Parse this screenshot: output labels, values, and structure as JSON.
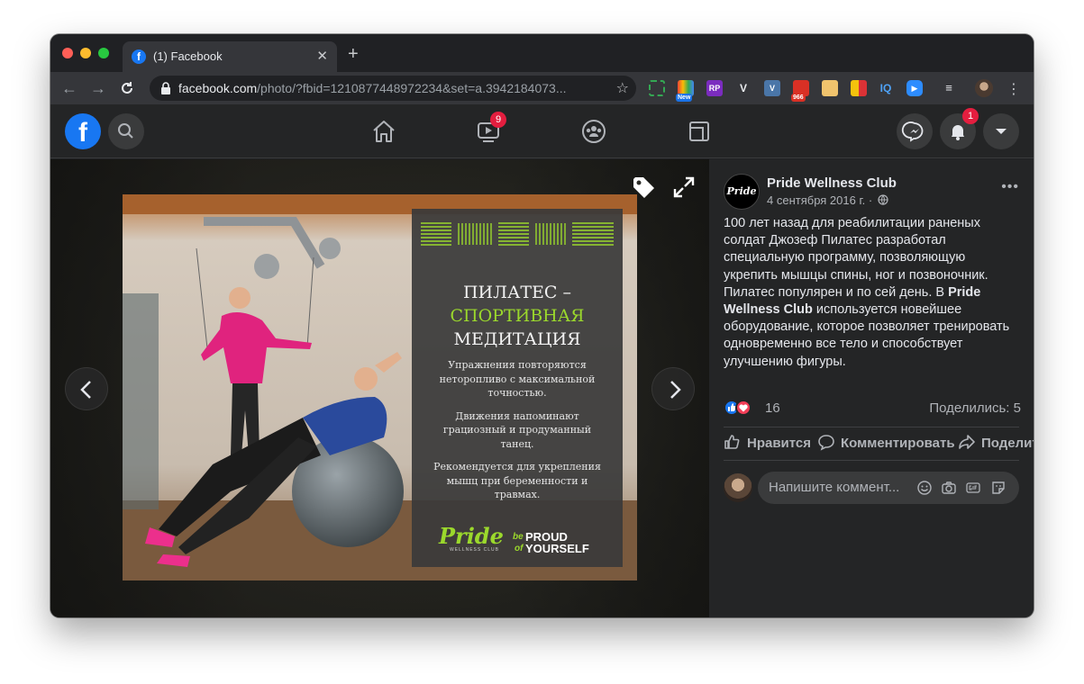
{
  "browser": {
    "tab_title": "(1) Facebook",
    "url_host": "facebook.com",
    "url_path": "/photo/?fbid=1210877448972234&set=a.3942184073...",
    "extensions": [
      {
        "name": "screenshot-ext",
        "badge": ""
      },
      {
        "name": "rainbow-ext",
        "badge": "New"
      },
      {
        "name": "rp-ext",
        "badge": ""
      },
      {
        "name": "v-ext",
        "badge": ""
      },
      {
        "name": "vk-ext",
        "badge": ""
      },
      {
        "name": "mail-ext",
        "badge": "966"
      },
      {
        "name": "box-ext",
        "badge": ""
      },
      {
        "name": "bookmark-ext",
        "badge": ""
      },
      {
        "name": "iq-ext",
        "badge": ""
      },
      {
        "name": "zoom-ext",
        "badge": ""
      }
    ],
    "ext_labels": {
      "rp": "RP",
      "v": "V",
      "vk": "V",
      "iq": "IQ"
    }
  },
  "fb_header": {
    "watch_badge": "9",
    "notifications_badge": "1"
  },
  "photo": {
    "card": {
      "title_line1": "ПИЛАТЕС –",
      "title_line2": "СПОРТИВНАЯ",
      "title_line3": "МЕДИТАЦИЯ",
      "para1": "Упражнения повторяются неторопливо с максимальной точностью.",
      "para2": "Движения напоминают грациозный и продуманный танец.",
      "para3": "Рекомендуется для укрепления мышц при беременности и травмах.",
      "brand": "Pride",
      "brand_sub": "WELLNESS CLUB",
      "slogan_be": "be",
      "slogan_proud": "PROUD",
      "slogan_of": "of",
      "slogan_yourself": "YOURSELF"
    }
  },
  "post": {
    "page_name": "Pride Wellness Club",
    "avatar_text": "Pride",
    "date": "4 сентября 2016 г. ·",
    "text_before": "100 лет назад для реабилитации раненых солдат Джозеф Пилатес разработал специальную программу, позволяющую укрепить мышцы спины, ног и позвоночник. Пилатес популярен и по сей день. В ",
    "text_bold": "Pride Wellness Club",
    "text_after": " используется новейшее оборудование, которое позволяет тренировать одновременно все тело и способствует улучшению фигуры.",
    "reactions_count": "16",
    "shares": "Поделились: 5",
    "like_label": "Нравится",
    "comment_label": "Комментировать",
    "share_label": "Поделиться",
    "comment_placeholder": "Напишите коммент..."
  },
  "colors": {
    "accent": "#1877f2",
    "lime": "#9bd82c",
    "badge_red": "#e41e3f"
  }
}
